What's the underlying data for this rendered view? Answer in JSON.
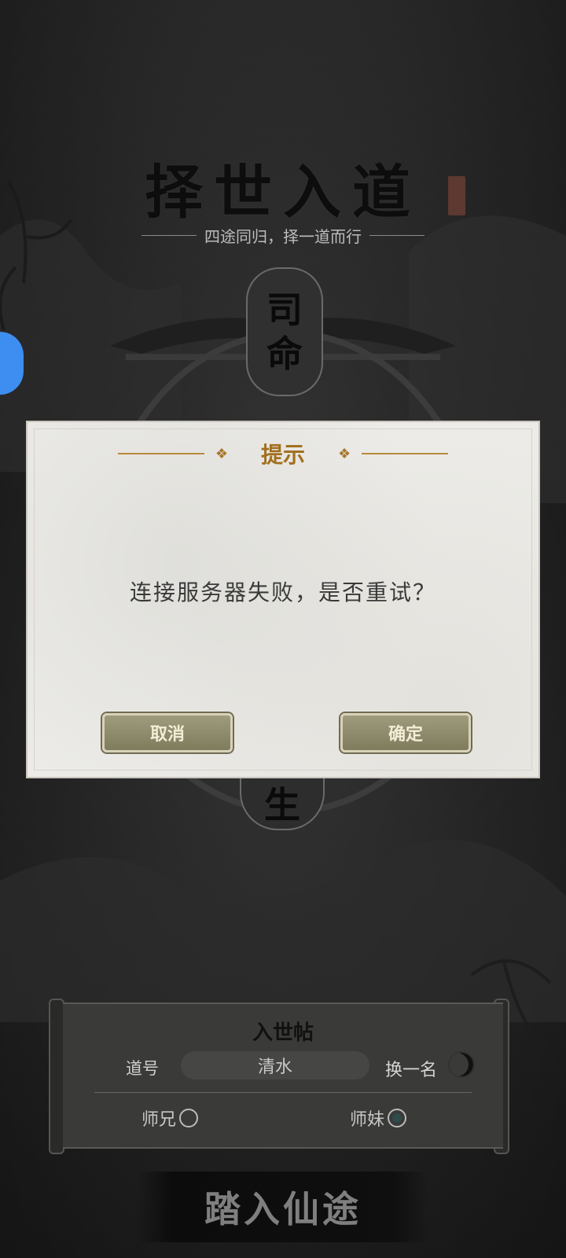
{
  "header": {
    "title": "择世入道",
    "subtitle": "四途同归，择一道而行"
  },
  "medallion": {
    "top_text_1": "司",
    "top_text_2": "命",
    "bottom_text": "生"
  },
  "dialog": {
    "title": "提示",
    "message": "连接服务器失败，是否重试？",
    "cancel_label": "取消",
    "ok_label": "确定"
  },
  "scroll": {
    "title": "入世帖",
    "name_label": "道号",
    "name_value": "清水",
    "change_name_label": "换一名",
    "gender_male": "师兄",
    "gender_female": "师妹",
    "selected_gender": "师妹"
  },
  "enter_button": "踏入仙途",
  "colors": {
    "dialog_title": "#a2701f",
    "button_bg": "#8f8c6e",
    "accent_blue": "#3d8ef0"
  }
}
